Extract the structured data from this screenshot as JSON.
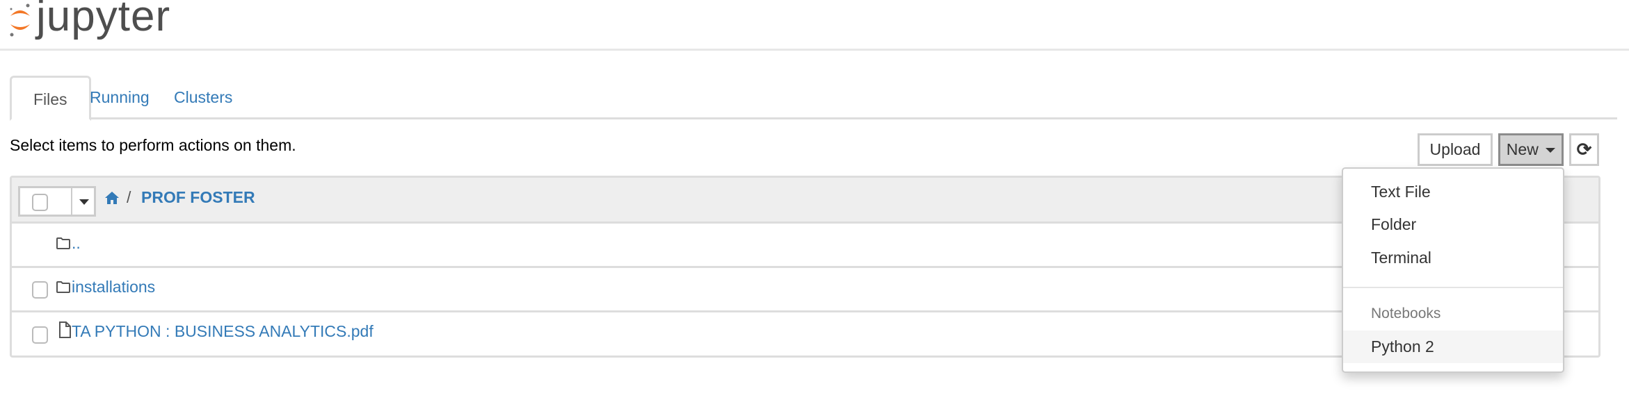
{
  "header": {
    "logo_text": "jupyter"
  },
  "tabs": [
    {
      "label": "Files"
    },
    {
      "label": "Running"
    },
    {
      "label": "Clusters"
    }
  ],
  "toolbar": {
    "hint": "Select items to perform actions on them.",
    "upload_label": "Upload",
    "new_label": "New"
  },
  "breadcrumb": {
    "separator": "/",
    "folder": "PROF FOSTER"
  },
  "files": [
    {
      "name": "..",
      "type": "folder"
    },
    {
      "name": "installations",
      "type": "folder"
    },
    {
      "name": "TA PYTHON : BUSINESS ANALYTICS.pdf",
      "type": "file"
    }
  ],
  "new_menu": {
    "items": [
      "Text File",
      "Folder",
      "Terminal"
    ],
    "section_header": "Notebooks",
    "notebooks": [
      "Python 2"
    ]
  },
  "colors": {
    "link": "#337ab7",
    "logo_orange": "#f37726"
  }
}
